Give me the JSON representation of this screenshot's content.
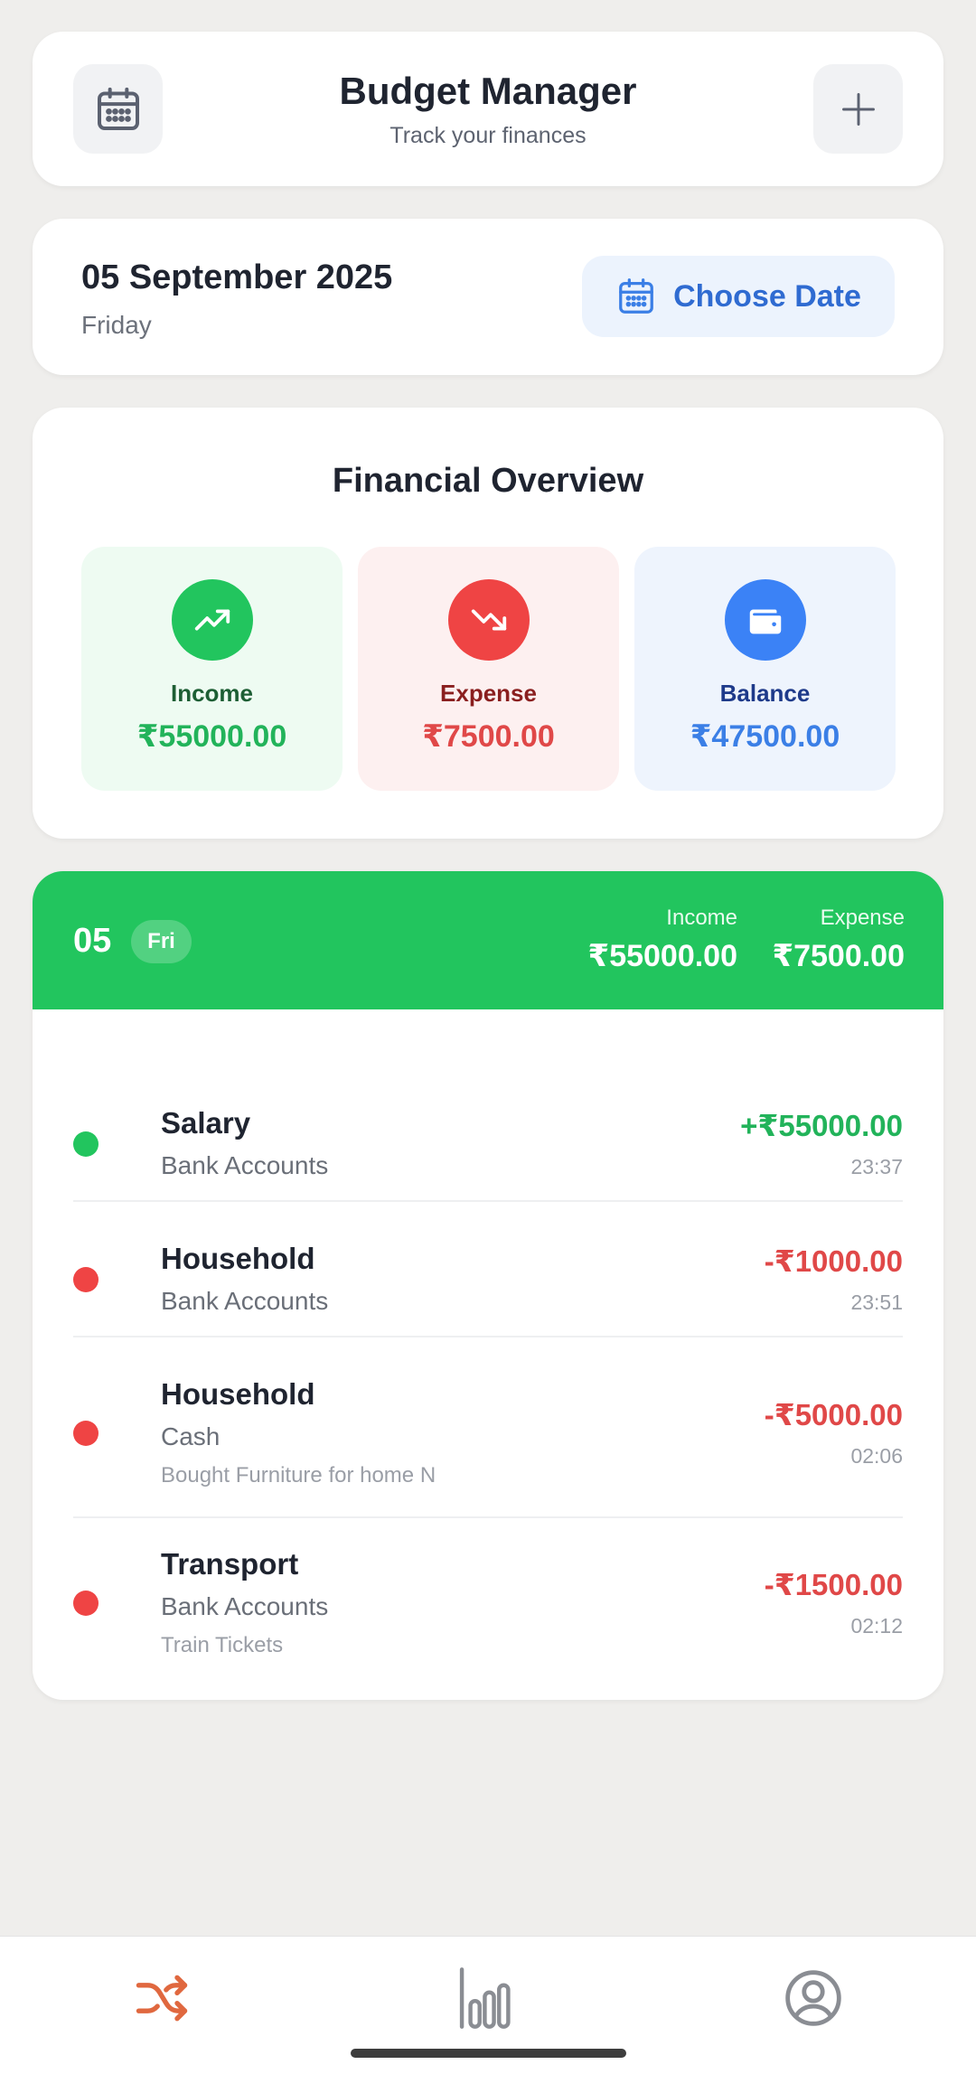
{
  "header": {
    "title": "Budget Manager",
    "subtitle": "Track your finances",
    "left_icon": "calendar-icon",
    "right_icon": "plus-icon"
  },
  "date_card": {
    "date": "05 September 2025",
    "weekday": "Friday",
    "choose_label": "Choose Date"
  },
  "overview": {
    "title": "Financial Overview",
    "income": {
      "label": "Income",
      "value": "₹55000.00",
      "icon": "trending-up-icon",
      "color": "#22c55e"
    },
    "expense": {
      "label": "Expense",
      "value": "₹7500.00",
      "icon": "trending-down-icon",
      "color": "#ef4444"
    },
    "balance": {
      "label": "Balance",
      "value": "₹47500.00",
      "icon": "wallet-icon",
      "color": "#3b82f6"
    }
  },
  "day_group": {
    "day": "05",
    "weekday_short": "Fri",
    "income_label": "Income",
    "income_value": "₹55000.00",
    "expense_label": "Expense",
    "expense_value": "₹7500.00",
    "transactions": [
      {
        "category": "Salary",
        "account": "Bank Accounts",
        "note": "",
        "amount": "+₹55000.00",
        "time": "23:37",
        "type": "income"
      },
      {
        "category": "Household",
        "account": "Bank Accounts",
        "note": "",
        "amount": "-₹1000.00",
        "time": "23:51",
        "type": "expense"
      },
      {
        "category": "Household",
        "account": "Cash",
        "note": "Bought Furniture for home N",
        "amount": "-₹5000.00",
        "time": "02:06",
        "type": "expense"
      },
      {
        "category": "Transport",
        "account": "Bank Accounts",
        "note": "Train Tickets",
        "amount": "-₹1500.00",
        "time": "02:12",
        "type": "expense"
      }
    ]
  },
  "bottom_nav": {
    "items": [
      {
        "icon": "shuffle-icon",
        "active": true
      },
      {
        "icon": "bar-chart-icon",
        "active": false
      },
      {
        "icon": "profile-icon",
        "active": false
      }
    ],
    "active_color": "#e0683f"
  }
}
